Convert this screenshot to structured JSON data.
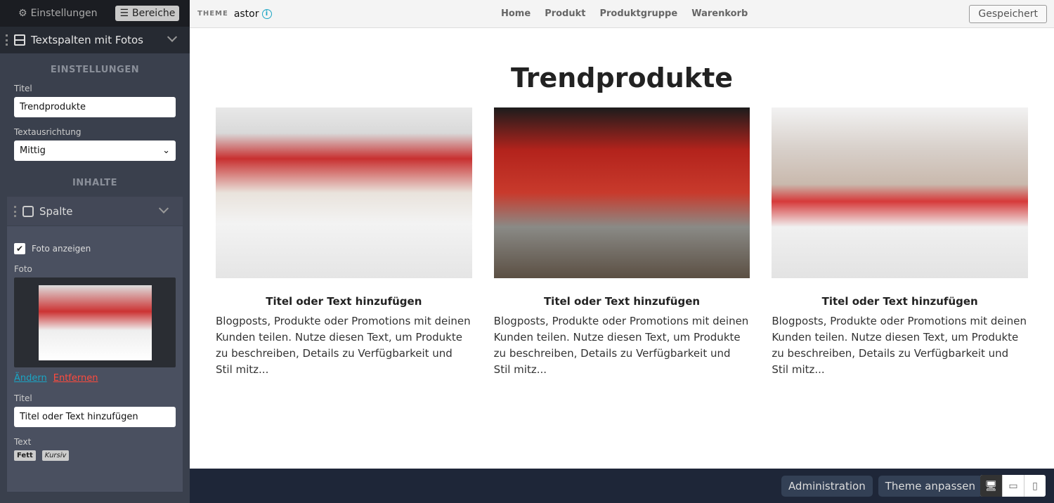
{
  "sidebar": {
    "tabs": [
      {
        "label": "Einstellungen",
        "icon": "gear-icon"
      },
      {
        "label": "Bereiche",
        "icon": "menu-icon"
      }
    ],
    "section_title": "Textspalten mit Fotos",
    "settings_heading": "EINSTELLUNGEN",
    "title_label": "Titel",
    "title_value": "Trendprodukte",
    "align_label": "Textausrichtung",
    "align_value": "Mittig",
    "content_heading": "INHALTE",
    "column": {
      "label": "Spalte",
      "show_photo_label": "Foto anzeigen",
      "show_photo": true,
      "photo_label": "Foto",
      "change": "Ändern",
      "remove": "Entfernen",
      "title_label": "Titel",
      "title_value": "Titel oder Text hinzufügen",
      "text_label": "Text",
      "bold": "Fett",
      "italic": "Kursiv"
    }
  },
  "topbar": {
    "theme_label": "THEME",
    "theme_name": "astor",
    "nav": [
      "Home",
      "Produkt",
      "Produktgruppe",
      "Warenkorb"
    ],
    "saved": "Gespeichert"
  },
  "main": {
    "heading": "Trendprodukte",
    "columns": [
      {
        "title": "Titel oder Text hinzufügen",
        "text": "Blogposts, Produkte oder Promotions mit deinen Kunden teilen. Nutze diesen Text, um Produkte zu beschreiben, Details zu Verfügbarkeit und Stil mitz..."
      },
      {
        "title": "Titel oder Text hinzufügen",
        "text": "Blogposts, Produkte oder Promotions mit deinen Kunden teilen. Nutze diesen Text, um Produkte zu beschreiben, Details zu Verfügbarkeit und Stil mitz..."
      },
      {
        "title": "Titel oder Text hinzufügen",
        "text": "Blogposts, Produkte oder Promotions mit deinen Kunden teilen. Nutze diesen Text, um Produkte zu beschreiben, Details zu Verfügbarkeit und Stil mitz..."
      }
    ]
  },
  "footer": {
    "admin": "Administration",
    "theme": "Theme anpassen"
  },
  "colors": {
    "link": "#1aa5c4",
    "remove": "#ff4a3d",
    "footer": "#1e2638"
  }
}
